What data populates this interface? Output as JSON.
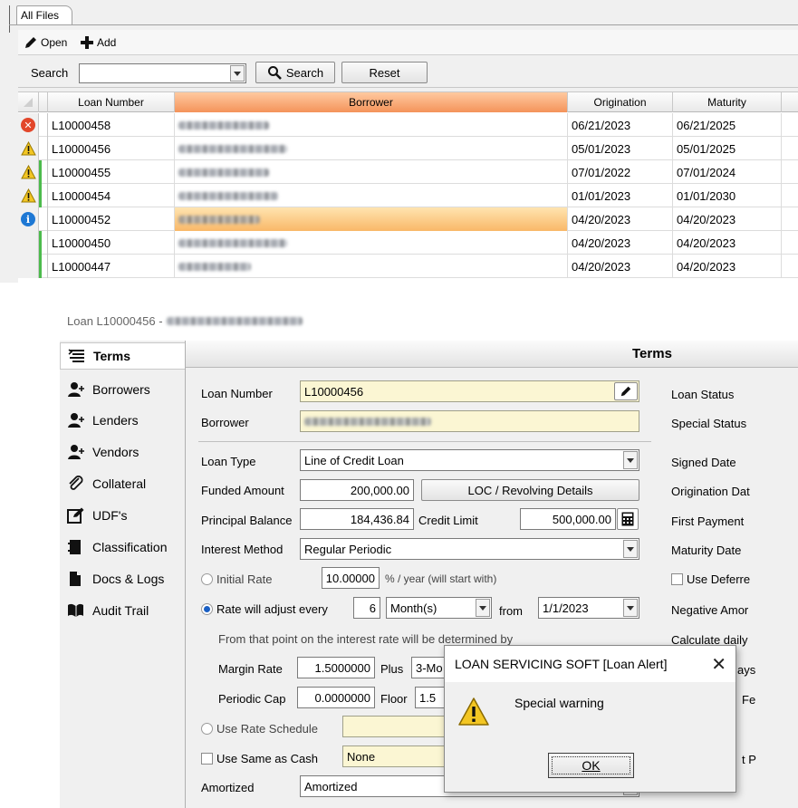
{
  "top_window": {
    "tab_label": "All Files",
    "toolbar": {
      "open_label": "Open",
      "add_label": "Add"
    },
    "search": {
      "label": "Search",
      "button_label": "Search",
      "reset_label": "Reset",
      "value": ""
    },
    "grid": {
      "columns": [
        "Loan Number",
        "Borrower",
        "Origination",
        "Maturity"
      ],
      "rows": [
        {
          "status": "error",
          "loan": "L10000458",
          "origination": "06/21/2023",
          "maturity": "06/21/2025"
        },
        {
          "status": "warning",
          "loan": "L10000456",
          "origination": "05/01/2023",
          "maturity": "05/01/2025"
        },
        {
          "status": "warning",
          "loan": "L10000455",
          "origination": "07/01/2022",
          "maturity": "07/01/2024"
        },
        {
          "status": "warning",
          "loan": "L10000454",
          "origination": "01/01/2023",
          "maturity": "01/01/2030"
        },
        {
          "status": "info",
          "loan": "L10000452",
          "origination": "04/20/2023",
          "maturity": "04/20/2023"
        },
        {
          "status": "none",
          "loan": "L10000450",
          "origination": "04/20/2023",
          "maturity": "04/20/2023"
        },
        {
          "status": "none",
          "loan": "L10000447",
          "origination": "04/20/2023",
          "maturity": "04/20/2023"
        }
      ]
    }
  },
  "loan_window": {
    "title": "Loan L10000456 -",
    "nav": [
      {
        "label": "Terms"
      },
      {
        "label": "Borrowers"
      },
      {
        "label": "Lenders"
      },
      {
        "label": "Vendors"
      },
      {
        "label": "Collateral"
      },
      {
        "label": "UDF's"
      },
      {
        "label": "Classification"
      },
      {
        "label": "Docs & Logs"
      },
      {
        "label": "Audit Trail"
      }
    ],
    "panel_title": "Terms",
    "fields": {
      "loan_number_label": "Loan Number",
      "loan_number": "L10000456",
      "borrower_label": "Borrower",
      "loan_type_label": "Loan Type",
      "loan_type": "Line of Credit Loan",
      "funded_amount_label": "Funded Amount",
      "funded_amount": "200,000.00",
      "loc_button": "LOC / Revolving Details",
      "principal_balance_label": "Principal Balance",
      "principal_balance": "184,436.84",
      "credit_limit_label": "Credit Limit",
      "credit_limit": "500,000.00",
      "interest_method_label": "Interest Method",
      "interest_method": "Regular Periodic",
      "initial_rate_label": "Initial Rate",
      "initial_rate": "10.00000",
      "initial_rate_suffix": "% / year (will start with)",
      "rate_adjust_label": "Rate will adjust every",
      "rate_adjust_every": "6",
      "rate_adjust_unit": "Month(s)",
      "from_label": "from",
      "from_date": "1/1/2023",
      "determined_text": "From that point on the interest rate will be determined by",
      "margin_rate_label": "Margin Rate",
      "margin_rate": "1.5000000",
      "plus_label": "Plus",
      "index_value": "3-Mo",
      "periodic_cap_label": "Periodic Cap",
      "periodic_cap": "0.0000000",
      "floor_label": "Floor",
      "floor_value": "1.5",
      "use_rate_schedule_label": "Use Rate Schedule",
      "use_same_as_cash_label": "Use Same as Cash",
      "same_as_cash_value": "None",
      "amortized_label": "Amortized",
      "amortized_value": "Amortized"
    },
    "right_labels": {
      "loan_status": "Loan Status",
      "special_status": "Special Status",
      "signed_date": "Signed Date",
      "origination_date": "Origination Dat",
      "first_payment": "First Payment",
      "maturity_date": "Maturity Date",
      "use_deferred": "Use Deferre",
      "negative_amort": "Negative Amor",
      "calculate_daily": "Calculate daily",
      "partial_1": "ays",
      "partial_2": "Fe",
      "partial_3": "t P"
    }
  },
  "dialog": {
    "title": "LOAN SERVICING SOFT [Loan Alert]",
    "message": "Special warning",
    "ok_label": "OK"
  },
  "colors": {
    "active_header": "#f4935a",
    "selected_row": "#f9b868",
    "yellow_field": "#fbf6d3",
    "green_stripe": "#4cbb4c",
    "error_icon": "#e2462a",
    "warning_icon": "#f3c623",
    "info_icon": "#1e78d4"
  }
}
